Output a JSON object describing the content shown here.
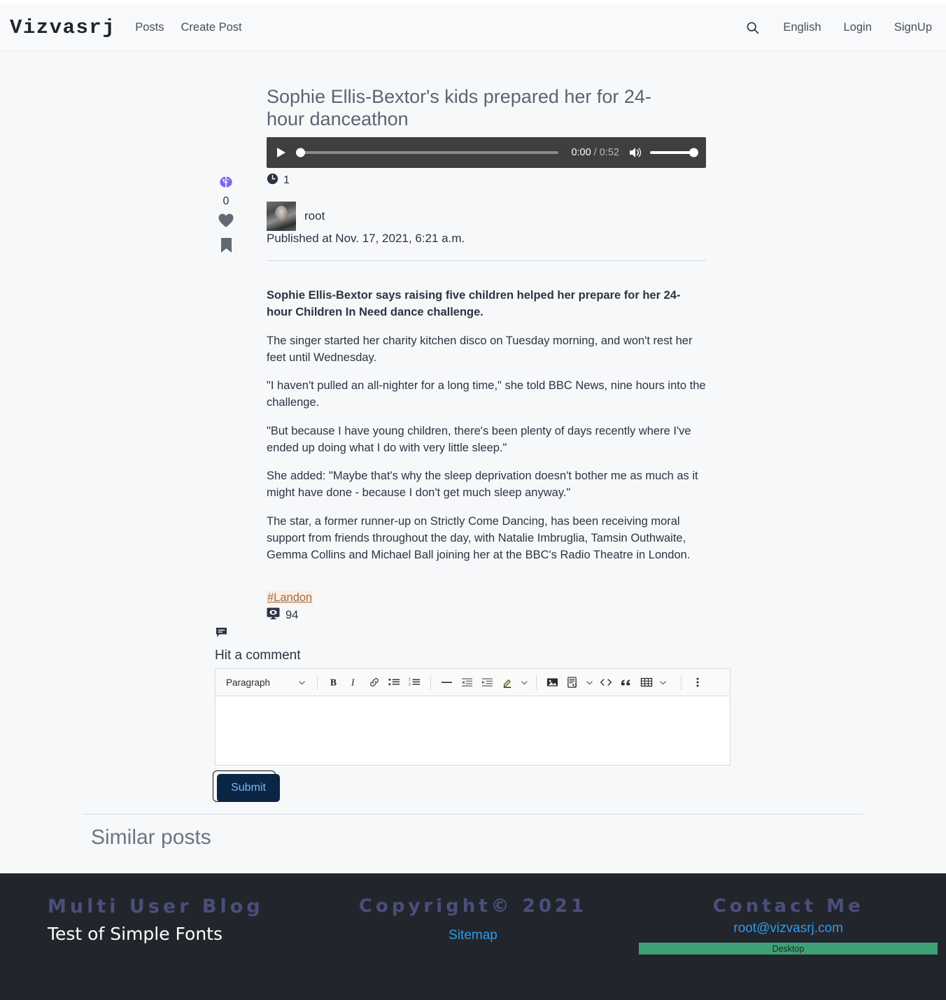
{
  "header": {
    "brand": "Vizvasrj",
    "nav_left": [
      {
        "label": "Posts",
        "name": "nav-posts"
      },
      {
        "label": "Create Post",
        "name": "nav-create-post"
      }
    ],
    "search_icon": "search-icon",
    "nav_right": [
      {
        "label": "English",
        "name": "nav-language"
      },
      {
        "label": "Login",
        "name": "nav-login"
      },
      {
        "label": "SignUp",
        "name": "nav-signup"
      }
    ]
  },
  "post": {
    "title": "Sophie Ellis-Bextor's kids prepared her for 24-hour danceathon",
    "read_time": "1",
    "author": "root",
    "published": "Published at Nov. 17, 2021, 6:21 a.m.",
    "hashtag": "#Landon",
    "views": "94",
    "rail": {
      "brain_icon": "brain-icon",
      "count": "0",
      "heart_icon": "heart-icon",
      "bookmark_icon": "bookmark-icon"
    },
    "paragraphs": [
      "Sophie Ellis-Bextor says raising five children helped her prepare for her 24-hour Children In Need dance challenge.",
      "The singer started her charity kitchen disco on Tuesday morning, and won't rest her feet until Wednesday.",
      "\"I haven't pulled an all-nighter for a long time,\" she told BBC News, nine hours into the challenge.",
      "\"But because I have young children, there's been plenty of days recently where I've ended up doing what I do with very little sleep.\"",
      "She added: \"Maybe that's why the sleep deprivation doesn't bother me as much as it might have done - because I don't get much sleep anyway.\"",
      "The star, a former runner-up on Strictly Come Dancing, has been receiving moral support from friends throughout the day, with Natalie Imbruglia, Tamsin Outhwaite, Gemma Collins and Michael Ball joining her at the BBC's Radio Theatre in London."
    ]
  },
  "audio": {
    "current_time": "0:00",
    "separator": " / ",
    "duration": "0:52",
    "play_icon": "play-icon",
    "mute_icon": "volume-icon"
  },
  "comments": {
    "icon": "comment-icon",
    "label": "Hit a comment",
    "editor": {
      "paragraph_select": "Paragraph",
      "buttons": [
        {
          "name": "bold-icon",
          "label": "B"
        },
        {
          "name": "italic-icon",
          "label": "I"
        },
        {
          "name": "link-icon",
          "label": "link"
        },
        {
          "name": "bulleted-list-icon",
          "label": "bulleted list"
        },
        {
          "name": "numbered-list-icon",
          "label": "numbered list"
        },
        {
          "name": "horizontal-rule-icon",
          "label": "horizontal line"
        },
        {
          "name": "outdent-icon",
          "label": "decrease indent"
        },
        {
          "name": "indent-icon",
          "label": "increase indent"
        },
        {
          "name": "highlight-icon",
          "label": "highlight"
        },
        {
          "name": "image-icon",
          "label": "insert image"
        },
        {
          "name": "template-icon",
          "label": "template"
        },
        {
          "name": "code-icon",
          "label": "code"
        },
        {
          "name": "blockquote-icon",
          "label": "block quote"
        },
        {
          "name": "table-icon",
          "label": "insert table"
        },
        {
          "name": "more-options-icon",
          "label": "more options"
        }
      ],
      "content": ""
    },
    "submit_label": "Submit"
  },
  "similar": {
    "heading": "Similar posts"
  },
  "footer": {
    "brand_title": "Multi User Blog",
    "brand_subtitle": "Test of Simple Fonts",
    "copyright_title": "Copyright© 2021",
    "sitemap_link": "Sitemap",
    "contact_title": "Contact Me",
    "contact_email": "root@vizvasrj.com",
    "device_badge": "Desktop"
  },
  "colors": {
    "accent_purple": "#7b68ee",
    "link_blue": "#2f9bea",
    "badge_green": "#3fa076",
    "submit_bg": "#0b2545",
    "submit_text": "#7cb6f5",
    "hashtag_bg": "#fceee2",
    "hashtag_text": "#9a6f4e",
    "footer_bg": "#22262c",
    "player_bg": "#3f3f3f"
  }
}
